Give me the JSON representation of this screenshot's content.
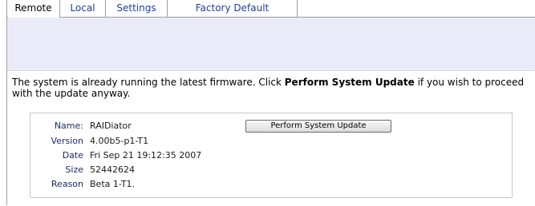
{
  "tabs": [
    {
      "label": "Remote",
      "active": true
    },
    {
      "label": "Local",
      "active": false
    },
    {
      "label": "Settings",
      "active": false
    },
    {
      "label": "Factory Default",
      "active": false
    }
  ],
  "message": {
    "text_before": "The system is already running the latest firmware. Click ",
    "emphasis": "Perform System Update",
    "text_after": " if you wish to proceed with the update anyway."
  },
  "firmware": {
    "name_label": "Name:",
    "name_value": "RAIDiator",
    "version_label": "Version",
    "version_value": "4.00b5-p1-T1",
    "date_label": "Date",
    "date_value": "Fri Sep 21 19:12:35 2007",
    "size_label": "Size",
    "size_value": "52442624",
    "reason_label": "Reason",
    "reason_value": "Beta 1-T1."
  },
  "update_button_label": "Perform System Update",
  "colors": {
    "tab_link": "#1c3fa8",
    "band": "#ebeaf8",
    "label": "#1a2a6a"
  }
}
